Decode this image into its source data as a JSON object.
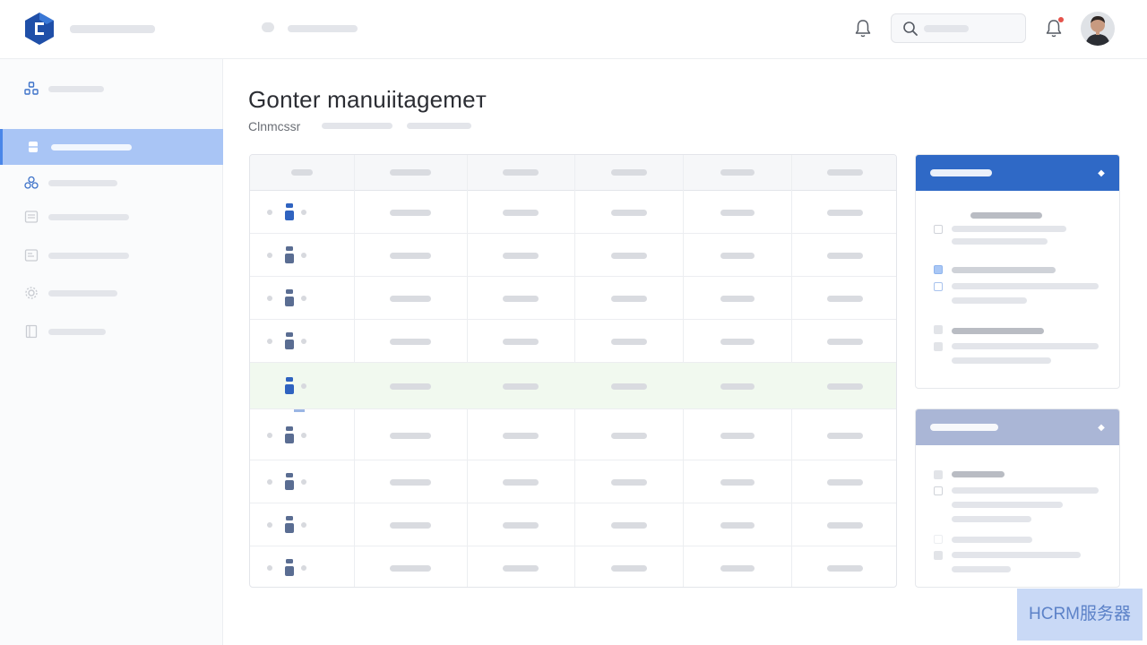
{
  "header": {
    "logo": "brand-logo",
    "icons": [
      "bell-icon",
      "search-icon",
      "bell-icon",
      "avatar"
    ],
    "notification_dot_color": "#e5534b"
  },
  "sidebar": {
    "active_index": 1,
    "active_color": "#a9c5f5",
    "items": [
      {
        "icon": "apps-icon"
      },
      {
        "icon": "folder-icon",
        "active": true
      },
      {
        "icon": "network-icon"
      },
      {
        "icon": "list-icon"
      },
      {
        "icon": "document-icon"
      },
      {
        "icon": "settings-icon"
      },
      {
        "icon": "book-icon"
      }
    ]
  },
  "page": {
    "title": "Gonter manuiitagemeт",
    "subtitle": "Clnmcssr"
  },
  "table": {
    "columns": 6,
    "rows": 9,
    "selected_row": 4,
    "selected_color": "#f1f9ef"
  },
  "panels": [
    {
      "header_color": "#2f69c6",
      "expand_icon": "◆"
    },
    {
      "header_color": "#aab6d6",
      "expand_icon": "◆"
    }
  ],
  "watermark": {
    "text": "HCRM服务器"
  }
}
